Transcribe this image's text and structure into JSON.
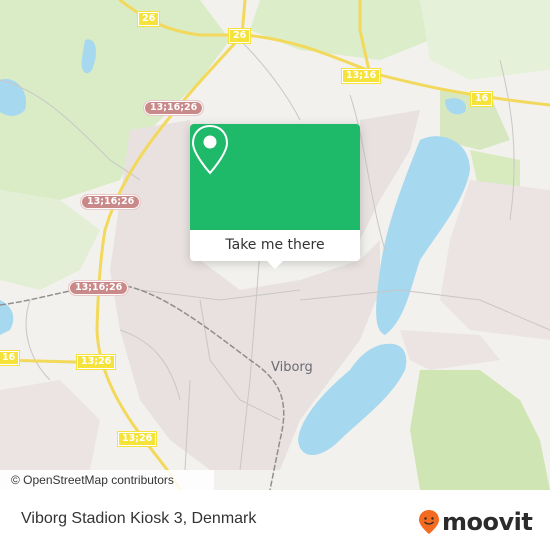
{
  "map": {
    "city_label": "Viborg",
    "attribution": "© OpenStreetMap contributors",
    "route_shields": [
      {
        "id": "shield-26-top-left",
        "label": "26",
        "style": "yellow"
      },
      {
        "id": "shield-26-top",
        "label": "26",
        "style": "yellow"
      },
      {
        "id": "shield-13-16",
        "label": "13;16",
        "style": "yellow"
      },
      {
        "id": "shield-16-east",
        "label": "16",
        "style": "yellow"
      },
      {
        "id": "shield-13-16-26-a",
        "label": "13;16;26",
        "style": "red"
      },
      {
        "id": "shield-13-16-26-b",
        "label": "13;16;26",
        "style": "red"
      },
      {
        "id": "shield-13-16-26-c",
        "label": "13;16;26",
        "style": "red"
      },
      {
        "id": "shield-16-west",
        "label": "16",
        "style": "yellow"
      },
      {
        "id": "shield-13-26-a",
        "label": "13;26",
        "style": "yellow"
      },
      {
        "id": "shield-13-26-b",
        "label": "13;26",
        "style": "yellow"
      }
    ],
    "colors": {
      "water": "#a6d8ef",
      "park": "#cfe6b4",
      "urban": "#e8e1df",
      "land": "#f2f1ee",
      "road_major": "#f2d95c",
      "accent_green": "#1fb96a"
    }
  },
  "popup": {
    "icon": "location-pin-icon",
    "action_label": "Take me there"
  },
  "footer": {
    "title": "Viborg Stadion Kiosk 3, Denmark",
    "brand": "moovit",
    "brand_color": "#f26b21"
  }
}
